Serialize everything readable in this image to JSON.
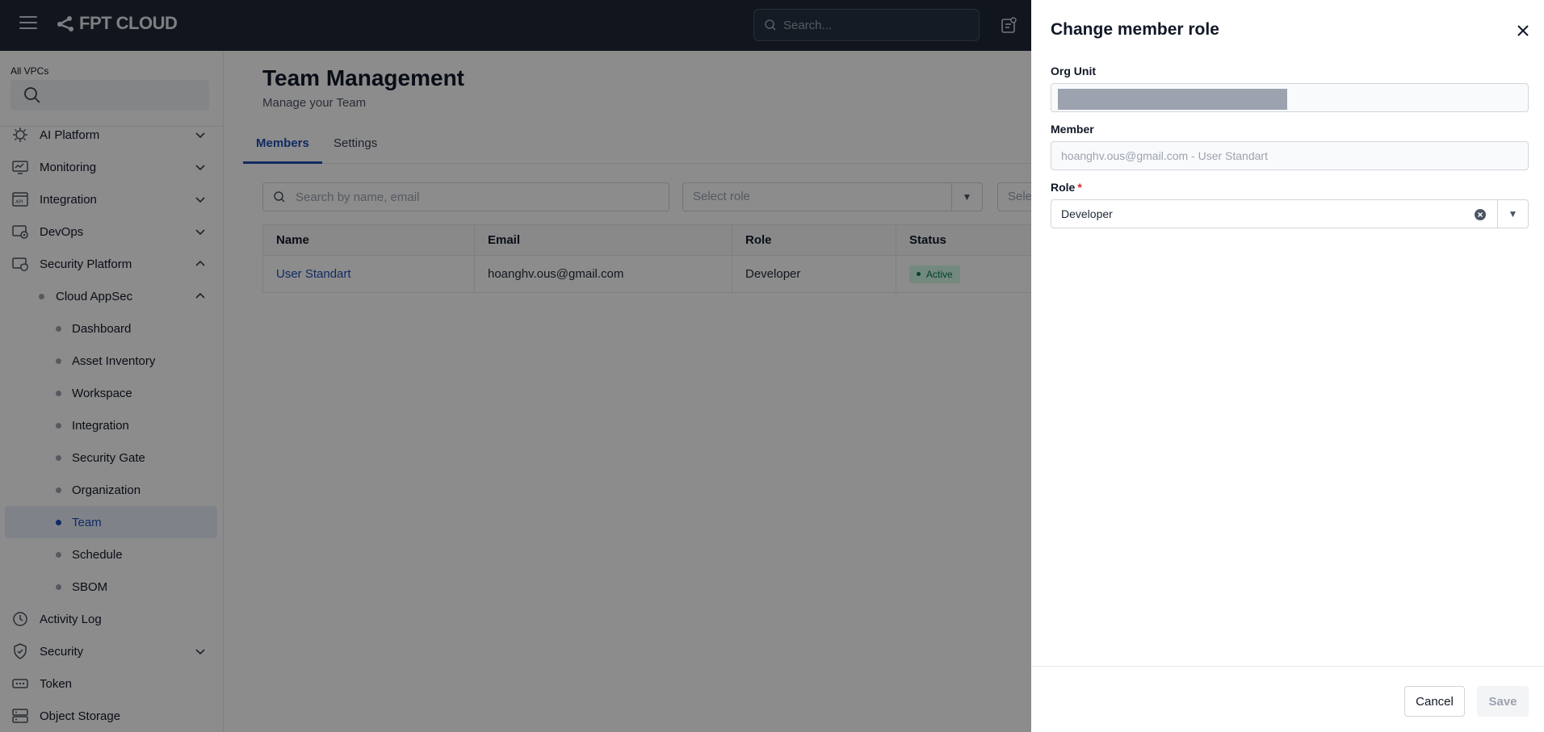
{
  "header": {
    "brand": "FPT CLOUD",
    "search_placeholder": "Search..."
  },
  "sidebar": {
    "vpc_label": "All VPCs",
    "items": [
      {
        "label": "AI Platform",
        "icon": "ai-platform-icon",
        "expanded": false
      },
      {
        "label": "Monitoring",
        "icon": "monitoring-icon",
        "expanded": false
      },
      {
        "label": "Integration",
        "icon": "api-icon",
        "expanded": false
      },
      {
        "label": "DevOps",
        "icon": "devops-icon",
        "expanded": false
      },
      {
        "label": "Security Platform",
        "icon": "security-platform-icon",
        "expanded": true
      },
      {
        "label": "Cloud AppSec",
        "expanded": true
      },
      {
        "label": "Dashboard"
      },
      {
        "label": "Asset Inventory"
      },
      {
        "label": "Workspace"
      },
      {
        "label": "Integration"
      },
      {
        "label": "Security Gate"
      },
      {
        "label": "Organization"
      },
      {
        "label": "Team",
        "active": true
      },
      {
        "label": "Schedule"
      },
      {
        "label": "SBOM"
      },
      {
        "label": "Activity Log",
        "icon": "clock-icon"
      },
      {
        "label": "Security",
        "icon": "shield-icon",
        "expanded": false
      },
      {
        "label": "Token",
        "icon": "token-icon"
      },
      {
        "label": "Object Storage",
        "icon": "storage-icon"
      }
    ]
  },
  "main": {
    "title": "Team Management",
    "subtitle": "Manage your Team",
    "tabs": [
      {
        "label": "Members",
        "active": true
      },
      {
        "label": "Settings",
        "active": false
      }
    ],
    "filters": {
      "search_placeholder": "Search by name, email",
      "role_placeholder": "Select role",
      "status_placeholder": "Sele"
    },
    "table": {
      "columns": [
        "Name",
        "Email",
        "Role",
        "Status"
      ],
      "rows": [
        {
          "name": "User Standart",
          "email": "hoanghv.ous@gmail.com",
          "role": "Developer",
          "status": "Active"
        }
      ]
    }
  },
  "drawer": {
    "title": "Change member role",
    "org_unit_label": "Org Unit",
    "member_label": "Member",
    "member_value": "hoanghv.ous@gmail.com - User Standart",
    "role_label": "Role",
    "role_required": "*",
    "role_value": "Developer",
    "cancel_label": "Cancel",
    "save_label": "Save"
  },
  "colors": {
    "topbar": "#1f2937",
    "accent": "#1e4fb5",
    "active_badge_bg": "#d1fae5",
    "active_badge_text": "#047857",
    "required": "#dc2626"
  }
}
